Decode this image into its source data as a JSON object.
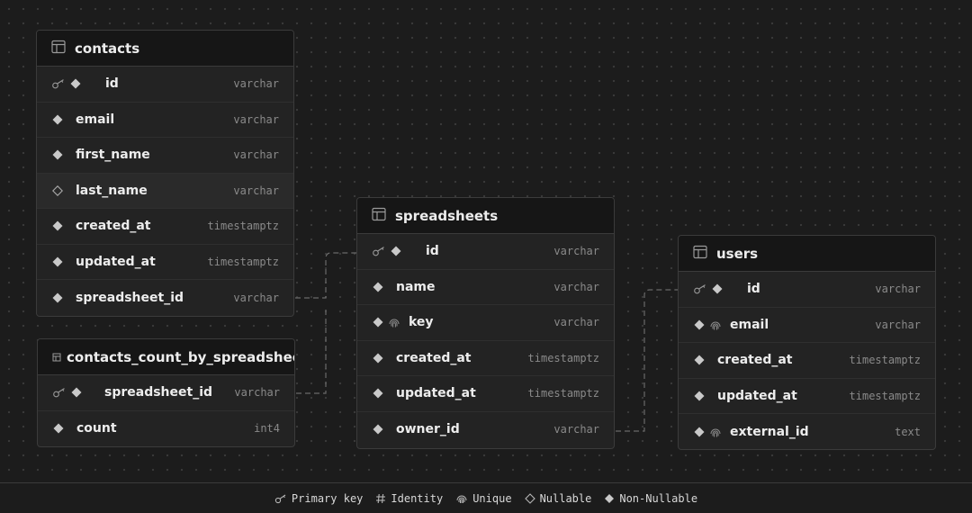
{
  "tables": [
    {
      "name": "contacts",
      "columns": [
        {
          "name": "id",
          "type": "varchar",
          "icons": [
            "primary-key",
            "non-nullable"
          ]
        },
        {
          "name": "email",
          "type": "varchar",
          "icons": [
            "non-nullable"
          ]
        },
        {
          "name": "first_name",
          "type": "varchar",
          "icons": [
            "non-nullable"
          ]
        },
        {
          "name": "last_name",
          "type": "varchar",
          "icons": [
            "nullable"
          ]
        },
        {
          "name": "created_at",
          "type": "timestamptz",
          "icons": [
            "non-nullable"
          ]
        },
        {
          "name": "updated_at",
          "type": "timestamptz",
          "icons": [
            "non-nullable"
          ]
        },
        {
          "name": "spreadsheet_id",
          "type": "varchar",
          "icons": [
            "non-nullable"
          ]
        }
      ]
    },
    {
      "name": "contacts_count_by_spreadsheets",
      "columns": [
        {
          "name": "spreadsheet_id",
          "type": "varchar",
          "icons": [
            "primary-key",
            "non-nullable"
          ]
        },
        {
          "name": "count",
          "type": "int4",
          "icons": [
            "non-nullable"
          ]
        }
      ]
    },
    {
      "name": "spreadsheets",
      "columns": [
        {
          "name": "id",
          "type": "varchar",
          "icons": [
            "primary-key",
            "non-nullable"
          ]
        },
        {
          "name": "name",
          "type": "varchar",
          "icons": [
            "non-nullable"
          ]
        },
        {
          "name": "key",
          "type": "varchar",
          "icons": [
            "non-nullable",
            "unique"
          ]
        },
        {
          "name": "created_at",
          "type": "timestamptz",
          "icons": [
            "non-nullable"
          ]
        },
        {
          "name": "updated_at",
          "type": "timestamptz",
          "icons": [
            "non-nullable"
          ]
        },
        {
          "name": "owner_id",
          "type": "varchar",
          "icons": [
            "non-nullable"
          ]
        }
      ]
    },
    {
      "name": "users",
      "columns": [
        {
          "name": "id",
          "type": "varchar",
          "icons": [
            "primary-key",
            "non-nullable"
          ]
        },
        {
          "name": "email",
          "type": "varchar",
          "icons": [
            "non-nullable",
            "unique"
          ]
        },
        {
          "name": "created_at",
          "type": "timestamptz",
          "icons": [
            "non-nullable"
          ]
        },
        {
          "name": "updated_at",
          "type": "timestamptz",
          "icons": [
            "non-nullable"
          ]
        },
        {
          "name": "external_id",
          "type": "text",
          "icons": [
            "non-nullable",
            "unique"
          ]
        }
      ]
    }
  ],
  "relations": [
    {
      "from": "contacts.spreadsheet_id",
      "to": "spreadsheets.id"
    },
    {
      "from": "contacts_count_by_spreadsheets.spreadsheet_id",
      "to": "spreadsheets.id"
    },
    {
      "from": "spreadsheets.owner_id",
      "to": "users.id"
    }
  ],
  "legend": {
    "primary_key": "Primary key",
    "identity": "Identity",
    "unique": "Unique",
    "nullable": "Nullable",
    "non_nullable": "Non-Nullable"
  }
}
